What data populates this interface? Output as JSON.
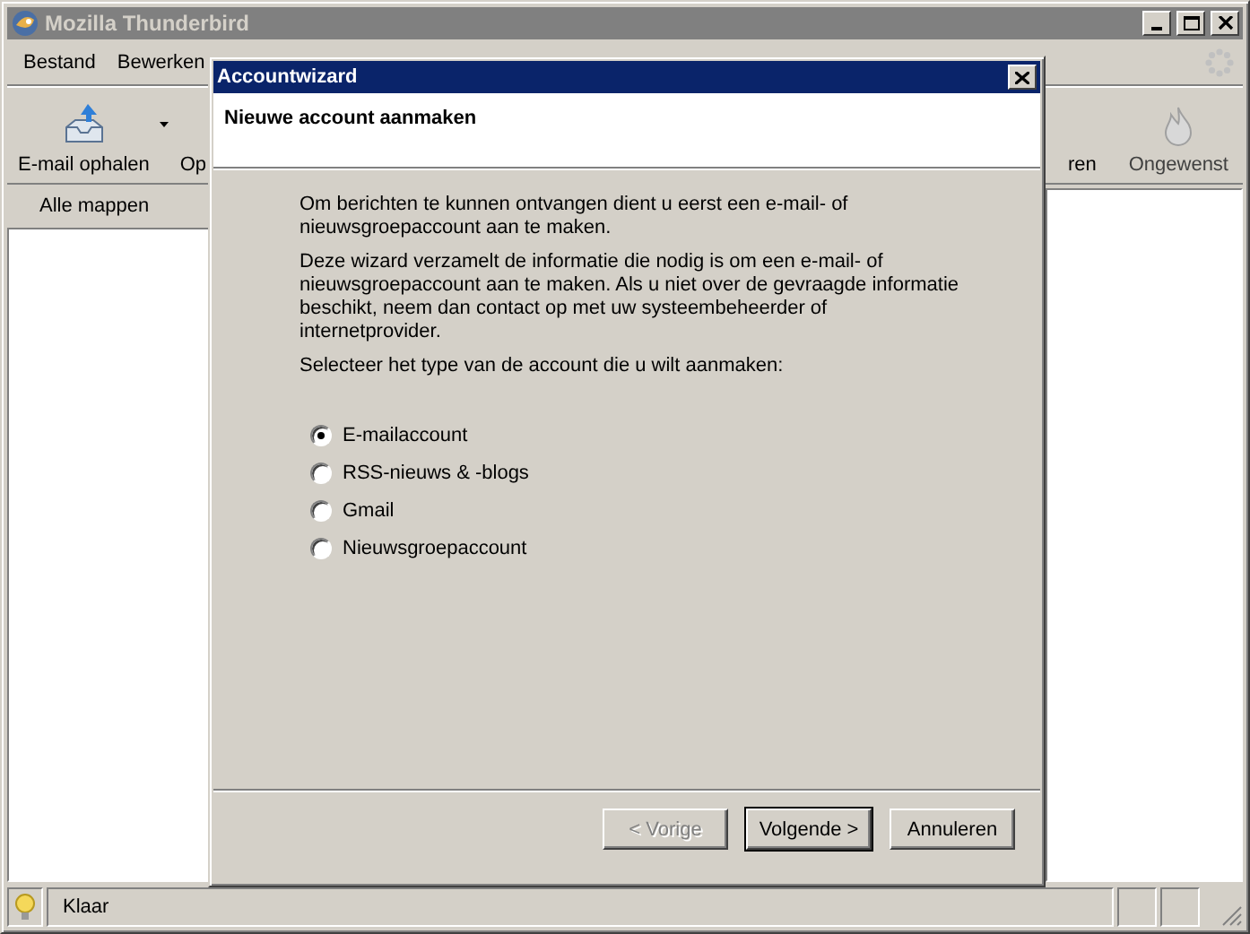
{
  "window": {
    "title": "Mozilla Thunderbird"
  },
  "menu": [
    "Bestand",
    "Bewerken"
  ],
  "toolbar": [
    {
      "label": "E-mail ophalen",
      "kind": "getmail"
    },
    {
      "label": "Op",
      "kind": "cut"
    },
    {
      "label": "ren",
      "kind": "cut"
    },
    {
      "label": "Ongewenst",
      "kind": "junk"
    }
  ],
  "folder_pane": {
    "header": "Alle mappen"
  },
  "dialog": {
    "title": "Accountwizard",
    "heading": "Nieuwe account aanmaken",
    "paragraphs": [
      "Om berichten te kunnen ontvangen dient u eerst een e-mail- of nieuwsgroepaccount aan te maken.",
      "Deze wizard verzamelt de informatie die nodig is om een e-mail- of nieuwsgroepaccount aan te maken. Als u niet over de gevraagde informatie beschikt, neem dan contact op met uw systeembeheerder of internetprovider.",
      "Selecteer het type van de account die u wilt aanmaken:"
    ],
    "options": [
      {
        "label": "E-mailaccount",
        "selected": true
      },
      {
        "label": "RSS-nieuws & -blogs",
        "selected": false
      },
      {
        "label": "Gmail",
        "selected": false
      },
      {
        "label": "Nieuwsgroepaccount",
        "selected": false
      }
    ],
    "buttons": [
      {
        "label": "< Vorige",
        "disabled": true,
        "default": false
      },
      {
        "label": "Volgende >",
        "disabled": false,
        "default": true
      },
      {
        "label": "Annuleren",
        "disabled": false,
        "default": false
      }
    ]
  },
  "status_bar": {
    "text": "Klaar"
  }
}
